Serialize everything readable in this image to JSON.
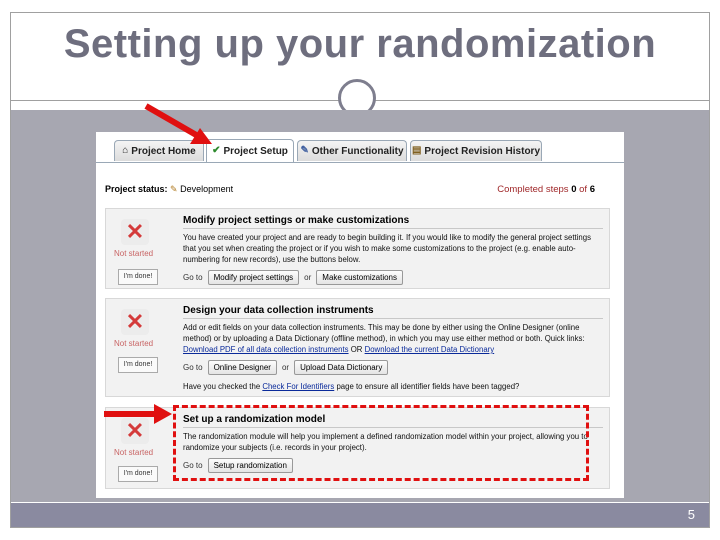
{
  "slide": {
    "title": "Setting up your randomization",
    "page_number": "5"
  },
  "tabs": [
    {
      "label": "Project Home",
      "icon": "house-icon"
    },
    {
      "label": "Project Setup",
      "icon": "checkmark-icon",
      "active": true
    },
    {
      "label": "Other Functionality",
      "icon": "pencil-icon"
    },
    {
      "label": "Project Revision History",
      "icon": "document-icon"
    }
  ],
  "status": {
    "label": "Project status:",
    "value": "Development",
    "completed_prefix": "Completed steps",
    "completed_done": "0",
    "completed_of": "of",
    "completed_total": "6"
  },
  "steps": [
    {
      "heading": "Modify project settings or make customizations",
      "text": "You have created your project and are ready to begin building it. If you would like to modify the general project settings that you set when creating the project or if you wish to make some customizations to the project (e.g. enable auto-numbering for new records), use the buttons below.",
      "goto": "Go to",
      "buttons": [
        "Modify project settings",
        "Make customizations"
      ],
      "or": "or",
      "state": "Not started",
      "done_label": "I'm done!"
    },
    {
      "heading": "Design your data collection instruments",
      "text_a": "Add or edit fields on your data collection instruments. This may be done by either using the Online Designer (online method) or by uploading a Data Dictionary (offline method), in which you may use either method or both. Quick links:",
      "link_a": "Download PDF of all data collection instruments",
      "text_b": "OR",
      "link_b": "Download the current Data Dictionary",
      "goto": "Go to",
      "buttons": [
        "Online Designer",
        "Upload Data Dictionary"
      ],
      "or": "or",
      "check_prefix": "Have you checked the",
      "check_link": "Check For Identifiers",
      "check_suffix": "page to ensure all identifier fields have been tagged?",
      "state": "Not started",
      "done_label": "I'm done!"
    },
    {
      "heading": "Set up a randomization model",
      "text": "The randomization module will help you implement a defined randomization model within your project, allowing you to randomize your subjects (i.e. records in your project).",
      "goto": "Go to",
      "buttons": [
        "Setup randomization"
      ],
      "state": "Not started",
      "done_label": "I'm done!"
    }
  ],
  "colors": {
    "title": "#6e6e7e",
    "accent_red": "#e01010",
    "footer": "#8a8aa0",
    "content_bg": "#a7a7b1"
  }
}
